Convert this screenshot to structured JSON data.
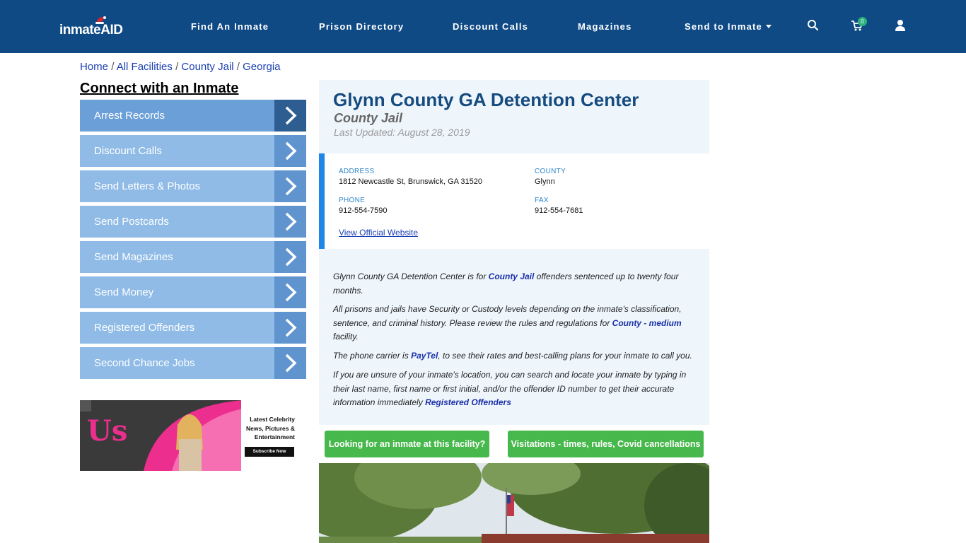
{
  "brand": {
    "logo_text": "inmate",
    "logo_accent": "AID",
    "header_color": "#0f4a85"
  },
  "nav": {
    "items": [
      "Find An Inmate",
      "Prison Directory",
      "Discount Calls",
      "Magazines",
      "Send to Inmate"
    ],
    "cart_count": "0",
    "icons": [
      "search-icon",
      "cart-icon",
      "user-icon"
    ]
  },
  "breadcrumb": [
    "Home",
    "All Facilities",
    "County Jail",
    "Georgia"
  ],
  "sidebar": {
    "title": "Connect with an Inmate",
    "items": [
      "Arrest Records",
      "Discount Calls",
      "Send Letters & Photos",
      "Send Postcards",
      "Send Magazines",
      "Send Money",
      "Registered Offenders",
      "Second Chance Jobs"
    ],
    "item_color": "#8fbbe6",
    "arrow_color": "#5f94cf"
  },
  "ad": {
    "brand": "Us",
    "line1": "Latest Celebrity",
    "line2": "News, Pictures &",
    "line3": "Entertainment",
    "cta": "Subscribe Now"
  },
  "facility": {
    "name": "Glynn County GA Detention Center",
    "type": "County Jail",
    "updated": "Last Updated: August 28, 2019",
    "address_label": "ADDRESS",
    "address": "1812 Newcastle St, Brunswick, GA 31520",
    "county_label": "COUNTY",
    "county": "Glynn",
    "phone_label": "PHONE",
    "phone": "912-554-7590",
    "fax_label": "FAX",
    "fax": "912-554-7681",
    "website_link": "View Official Website"
  },
  "description": {
    "p1_a": "Glynn County GA Detention Center is for ",
    "p1_link": "County Jail",
    "p1_b": " offenders sentenced up to twenty four months.",
    "p2_a": "All prisons and jails have Security or Custody levels depending on the inmate's classification, sentence, and criminal history. Please review the rules and regulations for ",
    "p2_link": "County - medium",
    "p2_b": " facility.",
    "p3_a": "The phone carrier is ",
    "p3_link": "PayTel",
    "p3_b": ", to see their rates and best-calling plans for your inmate to call you.",
    "p4_a": "If you are unsure of your inmate's location, you can search and locate your inmate by typing in their last name, first name or first initial, and/or the offender ID number to get their accurate information immediately ",
    "p4_link": "Registered Offenders"
  },
  "buttons": {
    "looking": "Looking for an inmate at this facility?",
    "visitations": "Visitations - times, rules, Covid cancellations"
  }
}
